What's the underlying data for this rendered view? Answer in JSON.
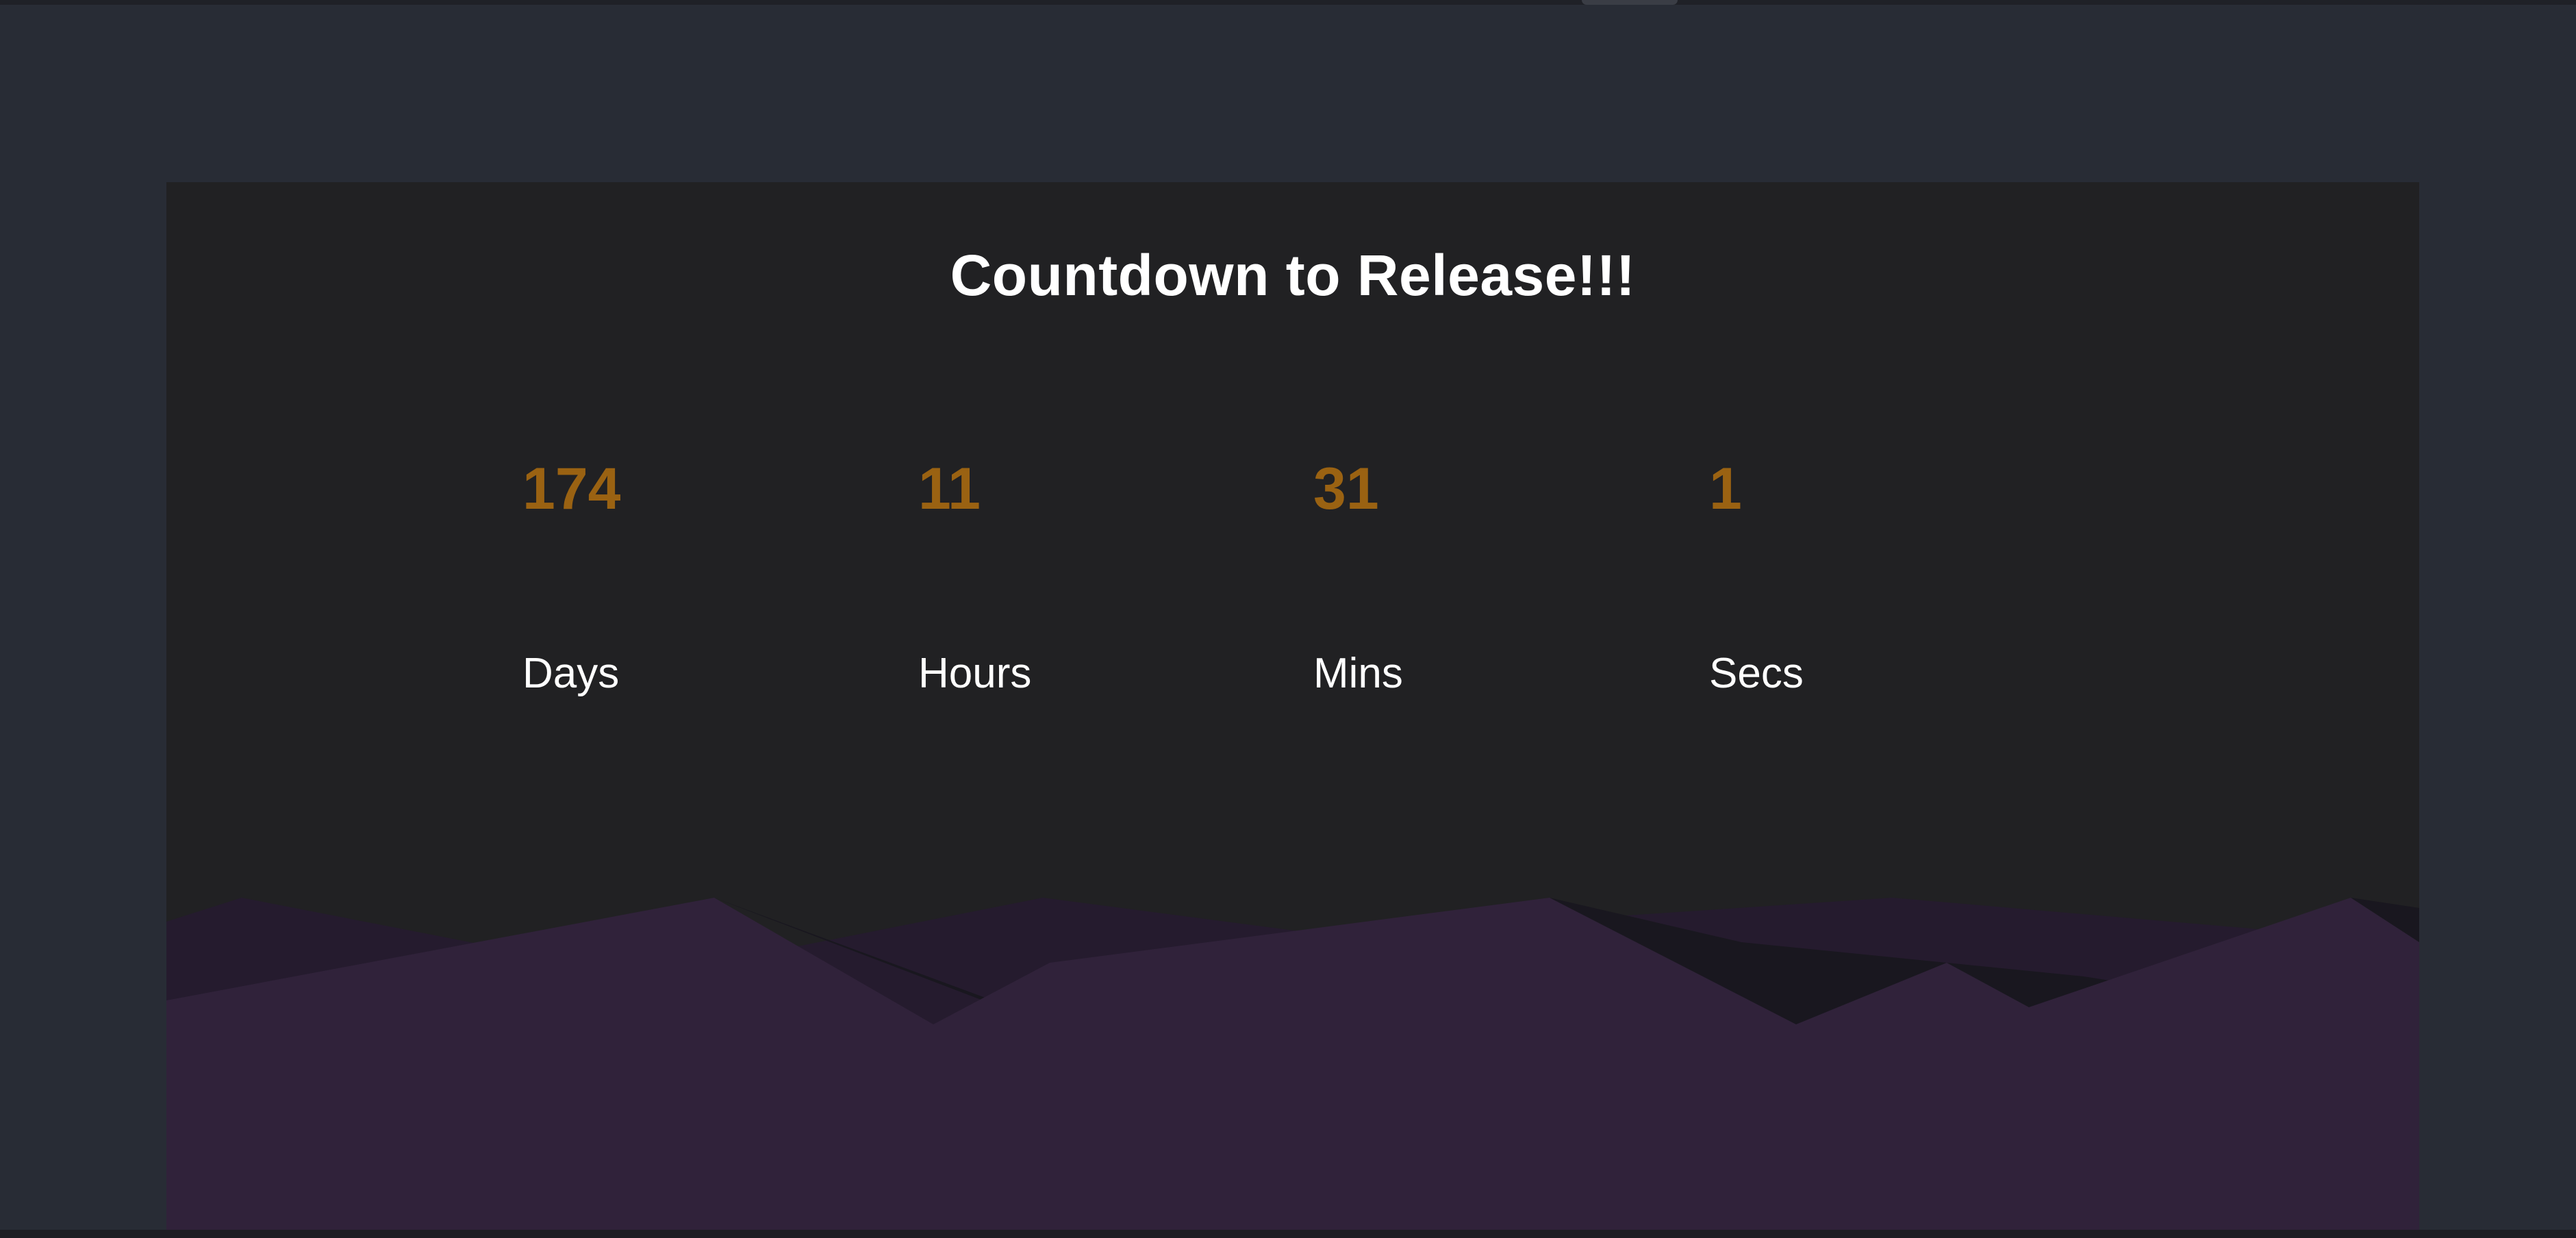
{
  "countdown": {
    "title": "Countdown to Release!!!",
    "units": [
      {
        "value": "174",
        "label": "Days"
      },
      {
        "value": "11",
        "label": "Hours"
      },
      {
        "value": "31",
        "label": "Mins"
      },
      {
        "value": "1",
        "label": "Secs"
      }
    ]
  },
  "colors": {
    "page_background": "#282c35",
    "panel_background": "#212123",
    "number_color": "#9a6212",
    "text_color": "#ffffff",
    "mountain_front": "#30223a",
    "mountain_back": "#251b2e"
  }
}
